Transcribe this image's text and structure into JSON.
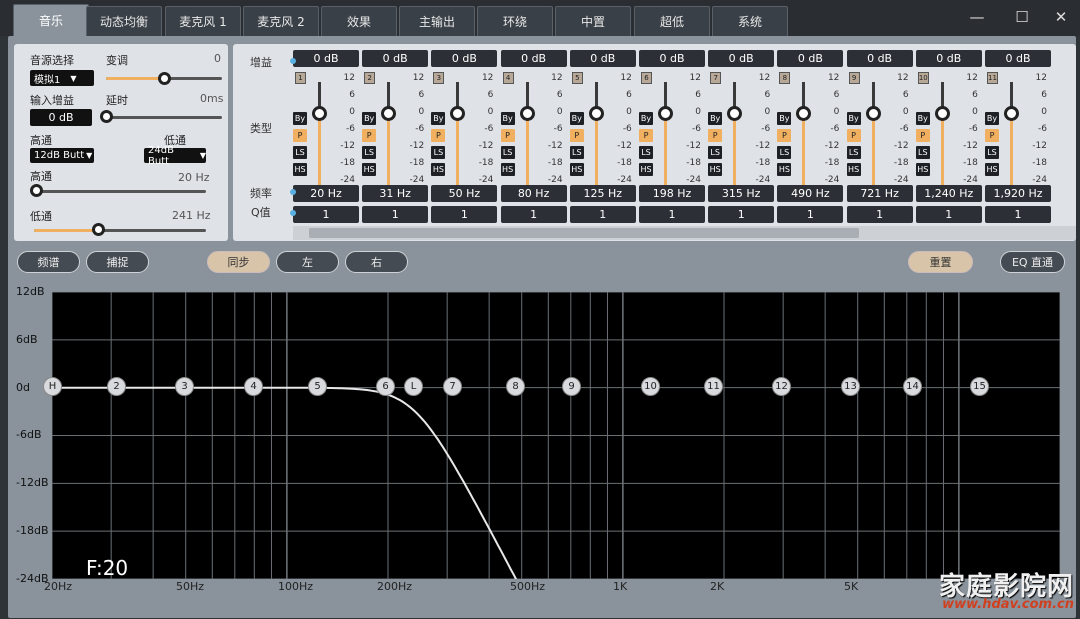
{
  "tabs": [
    "音乐",
    "动态均衡",
    "麦克风 1",
    "麦克风 2",
    "效果",
    "主输出",
    "环绕",
    "中置",
    "超低",
    "系统"
  ],
  "window": {
    "minimize": "—",
    "maximize": "☐",
    "close": "✕"
  },
  "left": {
    "source_label": "音源选择",
    "source_value": "模拟1",
    "transpose_label": "变调",
    "transpose_value": "0",
    "input_gain_label": "输入增益",
    "input_gain_value": "0 dB",
    "delay_label": "延时",
    "delay_value": "0ms",
    "hp_label": "高通",
    "lp_label": "低通",
    "hp_type": "12dB Butt",
    "lp_type": "24dB Butt",
    "hp_freq_label": "高通",
    "hp_freq_value": "20 Hz",
    "lp_freq_label": "低通",
    "lp_freq_value": "241 Hz"
  },
  "eq": {
    "gain_label": "增益",
    "type_label": "类型",
    "freq_label": "频率",
    "q_label": "Q值",
    "scale": [
      "12",
      "6",
      "0",
      "-6",
      "-12",
      "-18",
      "-24"
    ],
    "type_buttons": [
      "By",
      "P",
      "LS",
      "HS"
    ],
    "bands": [
      {
        "num": "1",
        "gain": "0 dB",
        "freq": "20 Hz",
        "q": "1"
      },
      {
        "num": "2",
        "gain": "0 dB",
        "freq": "31 Hz",
        "q": "1"
      },
      {
        "num": "3",
        "gain": "0 dB",
        "freq": "50 Hz",
        "q": "1"
      },
      {
        "num": "4",
        "gain": "0 dB",
        "freq": "80 Hz",
        "q": "1"
      },
      {
        "num": "5",
        "gain": "0 dB",
        "freq": "125 Hz",
        "q": "1"
      },
      {
        "num": "6",
        "gain": "0 dB",
        "freq": "198 Hz",
        "q": "1"
      },
      {
        "num": "7",
        "gain": "0 dB",
        "freq": "315 Hz",
        "q": "1"
      },
      {
        "num": "8",
        "gain": "0 dB",
        "freq": "490 Hz",
        "q": "1"
      },
      {
        "num": "9",
        "gain": "0 dB",
        "freq": "721 Hz",
        "q": "1"
      },
      {
        "num": "10",
        "gain": "0 dB",
        "freq": "1,240 Hz",
        "q": "1"
      },
      {
        "num": "11",
        "gain": "0 dB",
        "freq": "1,920 Hz",
        "q": "1"
      }
    ]
  },
  "toolbar": {
    "spectrum": "频谱",
    "capture": "捕捉",
    "sync": "同步",
    "left": "左",
    "right": "右",
    "reset": "重置",
    "bypass": "EQ 直通"
  },
  "graph": {
    "y_labels": [
      "12dB",
      "6dB",
      "0d",
      "-6dB",
      "-12dB",
      "-18dB",
      "-24dB"
    ],
    "x_labels": [
      "20Hz",
      "50Hz",
      "100Hz",
      "200Hz",
      "500Hz",
      "1K",
      "2K",
      "5K"
    ],
    "nodes": [
      "H",
      "2",
      "3",
      "4",
      "5",
      "6",
      "L",
      "7",
      "8",
      "9",
      "10",
      "11",
      "12",
      "13",
      "14",
      "15"
    ],
    "readout": "F:20"
  },
  "watermark": {
    "cn": "家庭影院网",
    "url": "www.hdav.com.cn"
  },
  "colors": {
    "accent": "#f0b060",
    "panel": "#dfe3e8",
    "graph_bg": "#000000"
  }
}
